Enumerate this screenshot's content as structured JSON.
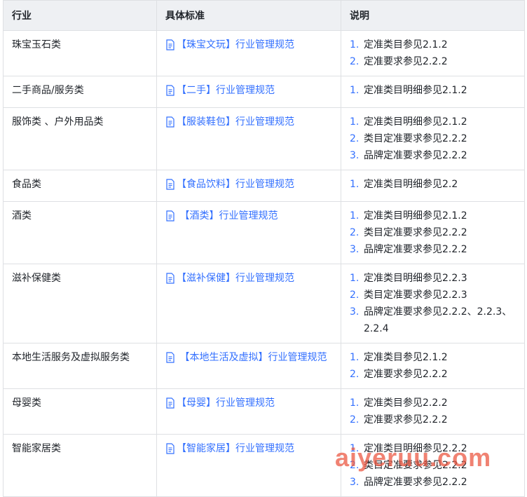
{
  "headers": [
    "行业",
    "具体标准",
    "说明"
  ],
  "rows": [
    {
      "industry": "珠宝玉石类",
      "standard": "【珠宝文玩】行业管理规范",
      "notes": [
        "定准类目参见2.1.2",
        "定准要求参见2.2.2"
      ]
    },
    {
      "industry": "二手商品/服务类",
      "standard": "【二手】行业管理规范",
      "notes": [
        "定准类目明细参见2.1.2"
      ]
    },
    {
      "industry": "服饰类 、户外用品类",
      "standard": "【服装鞋包】行业管理规范",
      "notes": [
        "定准类目明细参见2.1.2",
        "类目定准要求参见2.2.2",
        "品牌定准要求参见2.2.2"
      ]
    },
    {
      "industry": "食品类",
      "standard": "【食品饮料】行业管理规范",
      "notes": [
        "定准类目明细参见2.2"
      ]
    },
    {
      "industry": "酒类",
      "standard": " 【酒类】行业管理规范",
      "notes": [
        "定准类目明细参见2.1.2",
        "类目定准要求参见2.2.2",
        "品牌定准要求参见2.2.2"
      ]
    },
    {
      "industry": "滋补保健类",
      "standard": "【滋补保健】行业管理规范",
      "notes": [
        "定准类目明细参见2.2.3",
        "类目定准要求参见2.2.3",
        "品牌定准要求参见2.2.2、2.2.3、2.2.4"
      ]
    },
    {
      "industry": "本地生活服务及虚拟服务类",
      "standard": " 【本地生活及虚拟】行业管理规范",
      "notes": [
        "定准类目参见2.1.2",
        "定准要求参见2.2.2"
      ]
    },
    {
      "industry": "母婴类",
      "standard": "【母婴】行业管理规范",
      "notes": [
        "定准类目参见2.2.2",
        "定准要求参见2.2.2"
      ]
    },
    {
      "industry": "智能家居类",
      "standard": "【智能家居】行业管理规范",
      "notes": [
        "定准类目明细参见2.2.2",
        "类目定准要求参见2.2.2",
        "品牌定准要求参见2.2.2"
      ]
    }
  ],
  "watermark": "aiyeruu.com",
  "colors": {
    "link": "#3370ff",
    "header_bg": "#eef0f3",
    "border": "#dee0e3",
    "watermark": "#ea523c"
  },
  "icon": "document-icon"
}
